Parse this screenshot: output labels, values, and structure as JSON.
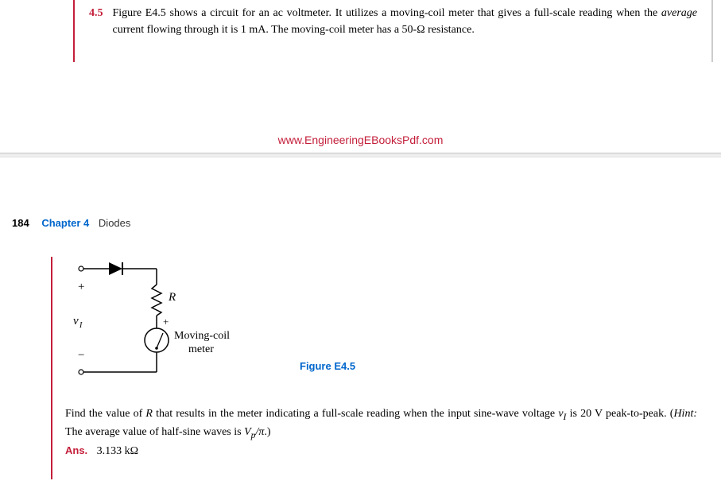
{
  "exercise": {
    "number": "4.5",
    "text_part1": "Figure E4.5 shows a circuit for an ac voltmeter. It utilizes a moving-coil meter that gives a full-scale reading when the ",
    "text_italic": "average",
    "text_part2": " current flowing through it is 1 mA. The moving-coil meter has a 50-Ω resistance."
  },
  "watermark": "www.EngineeringEBooksPdf.com",
  "page": {
    "number": "184",
    "chapter_label": "Chapter 4",
    "chapter_title": "Diodes"
  },
  "circuit": {
    "input_label": "v",
    "input_subscript": "I",
    "plus": "+",
    "minus": "−",
    "resistor_label": "R",
    "meter_plus": "+",
    "meter_label_line1": "Moving-coil",
    "meter_label_line2": "meter"
  },
  "figure_caption": "Figure E4.5",
  "question": {
    "text_part1": "Find the value of ",
    "r_var": "R",
    "text_part2": " that results in the meter indicating a full-scale reading when the input sine-wave voltage ",
    "v_var": "v",
    "v_sub": "I",
    "text_part3": " is 20 V peak-to-peak. (",
    "hint_label": "Hint:",
    "hint_text": " The average value of half-sine waves is ",
    "vp_var": "V",
    "vp_sub": "p",
    "pi_expr": "/π",
    "text_end": ".)"
  },
  "answer": {
    "label": "Ans.",
    "value": "3.133 kΩ"
  }
}
